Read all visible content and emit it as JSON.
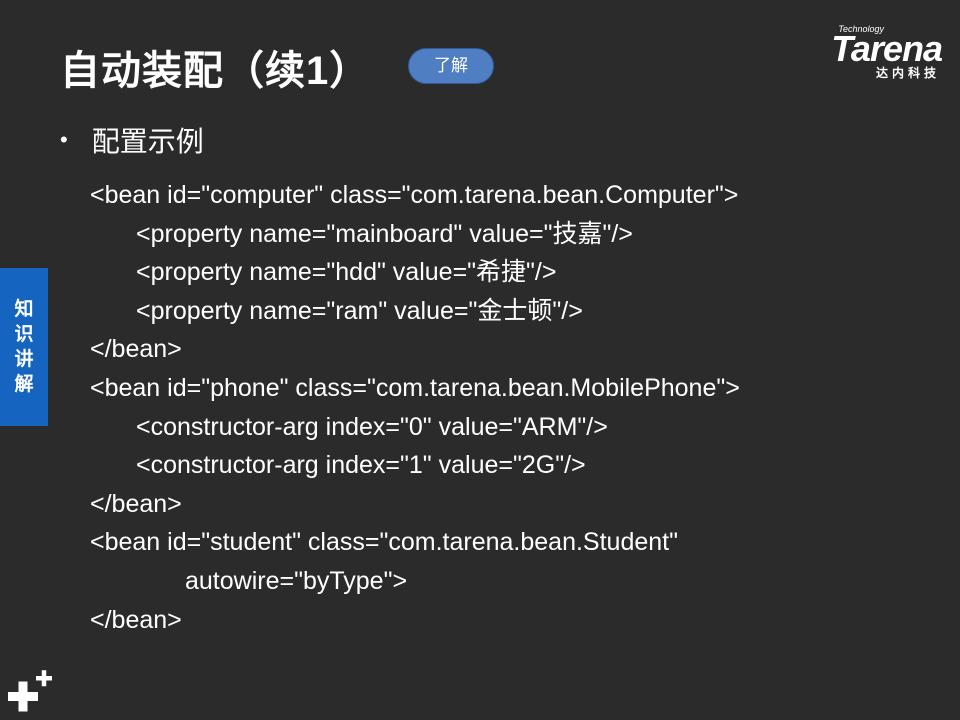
{
  "slide": {
    "title": "自动装配（续1）",
    "badge": "了解",
    "side_tab": [
      "知",
      "识",
      "讲",
      "解"
    ],
    "bullet": "配置示例",
    "logo": {
      "technology": "Technology",
      "brand": "Tarena",
      "sub": "达内科技"
    },
    "code_lines": [
      {
        "indent": 0,
        "text": "<bean id=\"computer\" class=\"com.tarena.bean.Computer\">"
      },
      {
        "indent": 1,
        "text": "<property name=\"mainboard\" value=\"技嘉\"/>"
      },
      {
        "indent": 1,
        "text": "<property name=\"hdd\" value=\"希捷\"/>"
      },
      {
        "indent": 1,
        "text": "<property name=\"ram\" value=\"金士顿\"/>"
      },
      {
        "indent": 0,
        "text": "</bean>"
      },
      {
        "indent": 0,
        "text": "<bean id=\"phone\" class=\"com.tarena.bean.MobilePhone\">"
      },
      {
        "indent": 1,
        "text": "<constructor-arg index=\"0\" value=\"ARM\"/>"
      },
      {
        "indent": 1,
        "text": "<constructor-arg index=\"1\" value=\"2G\"/>"
      },
      {
        "indent": 0,
        "text": "</bean>"
      },
      {
        "indent": 0,
        "text": "<bean id=\"student\" class=\"com.tarena.bean.Student\""
      },
      {
        "indent": 2,
        "text": "autowire=\"byType\">"
      },
      {
        "indent": 0,
        "text": "</bean>"
      }
    ],
    "colors": {
      "background": "#2b2b2b",
      "badge": "#4f7fc2",
      "side_tab": "#1565c0"
    },
    "icons": {
      "bullet": "bullet-dot-icon",
      "corner": "plus-icon"
    }
  }
}
